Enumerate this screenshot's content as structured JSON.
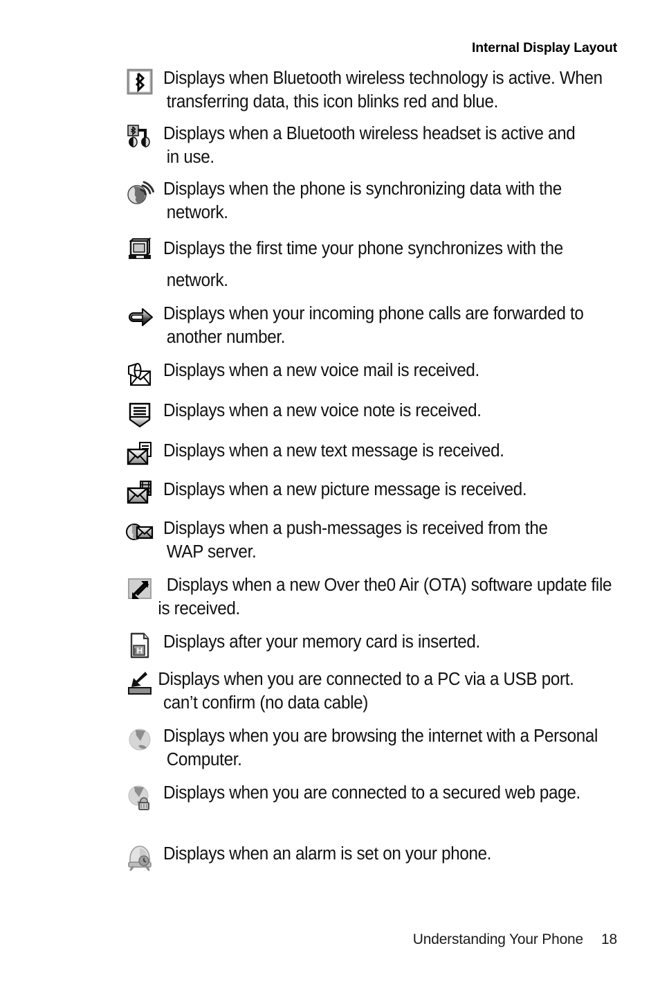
{
  "header": {
    "title": "Internal Display Layout"
  },
  "footer": {
    "section": "Understanding Your Phone",
    "page_number": "18"
  },
  "colors": {
    "text": "#111111",
    "icon_fill_light": "#d9d9d9",
    "icon_fill_mid": "#a6a6a6",
    "icon_fill_dark": "#4d4d4d",
    "icon_outline": "#000000"
  },
  "rows": [
    {
      "icon": "bluetooth-active-icon",
      "lines": [
        "Displays when Bluetooth wireless technology is active. When",
        "transferring data, this icon blinks red and blue."
      ]
    },
    {
      "icon": "bluetooth-headset-icon",
      "lines": [
        "Displays when a Bluetooth wireless headset is active and",
        "in use."
      ]
    },
    {
      "icon": "network-sync-icon",
      "lines": [
        "Displays when the phone is synchronizing data with the",
        "network."
      ]
    },
    {
      "icon": "first-sync-computer-icon",
      "lines": [
        "Displays the first time your phone synchronizes with the",
        "network."
      ]
    },
    {
      "icon": "call-forward-icon",
      "lines": [
        "Displays when your incoming phone calls are forwarded to",
        "another number."
      ]
    },
    {
      "icon": "voice-mail-icon",
      "lines": [
        "Displays when a new voice mail is received."
      ]
    },
    {
      "icon": "voice-note-icon",
      "lines": [
        "Displays when a new voice note is received."
      ]
    },
    {
      "icon": "text-message-icon",
      "lines": [
        "Displays when a new text message is received."
      ]
    },
    {
      "icon": "picture-message-icon",
      "lines": [
        "Displays when a new picture message is received."
      ]
    },
    {
      "icon": "push-message-icon",
      "lines": [
        "Displays when a push-messages is received from the",
        "WAP server."
      ]
    },
    {
      "icon": "ota-update-icon",
      "lines": [
        "Displays when a new Over the0 Air (OTA) software update file",
        "is received."
      ]
    },
    {
      "icon": "memory-card-icon",
      "lines": [
        "Displays after your memory card is inserted."
      ]
    },
    {
      "icon": "usb-connection-icon",
      "lines": [
        "Displays when you are connected to a PC via a USB port.",
        "can’t confirm (no data cable)"
      ]
    },
    {
      "icon": "pc-browsing-icon",
      "lines": [
        "Displays when you are browsing the internet with a Personal",
        "Computer."
      ]
    },
    {
      "icon": "secure-web-icon",
      "lines": [
        "Displays when you are connected to a secured web page."
      ]
    },
    {
      "icon": "alarm-clock-icon",
      "lines": [
        "Displays when an alarm is set on your phone."
      ]
    }
  ]
}
